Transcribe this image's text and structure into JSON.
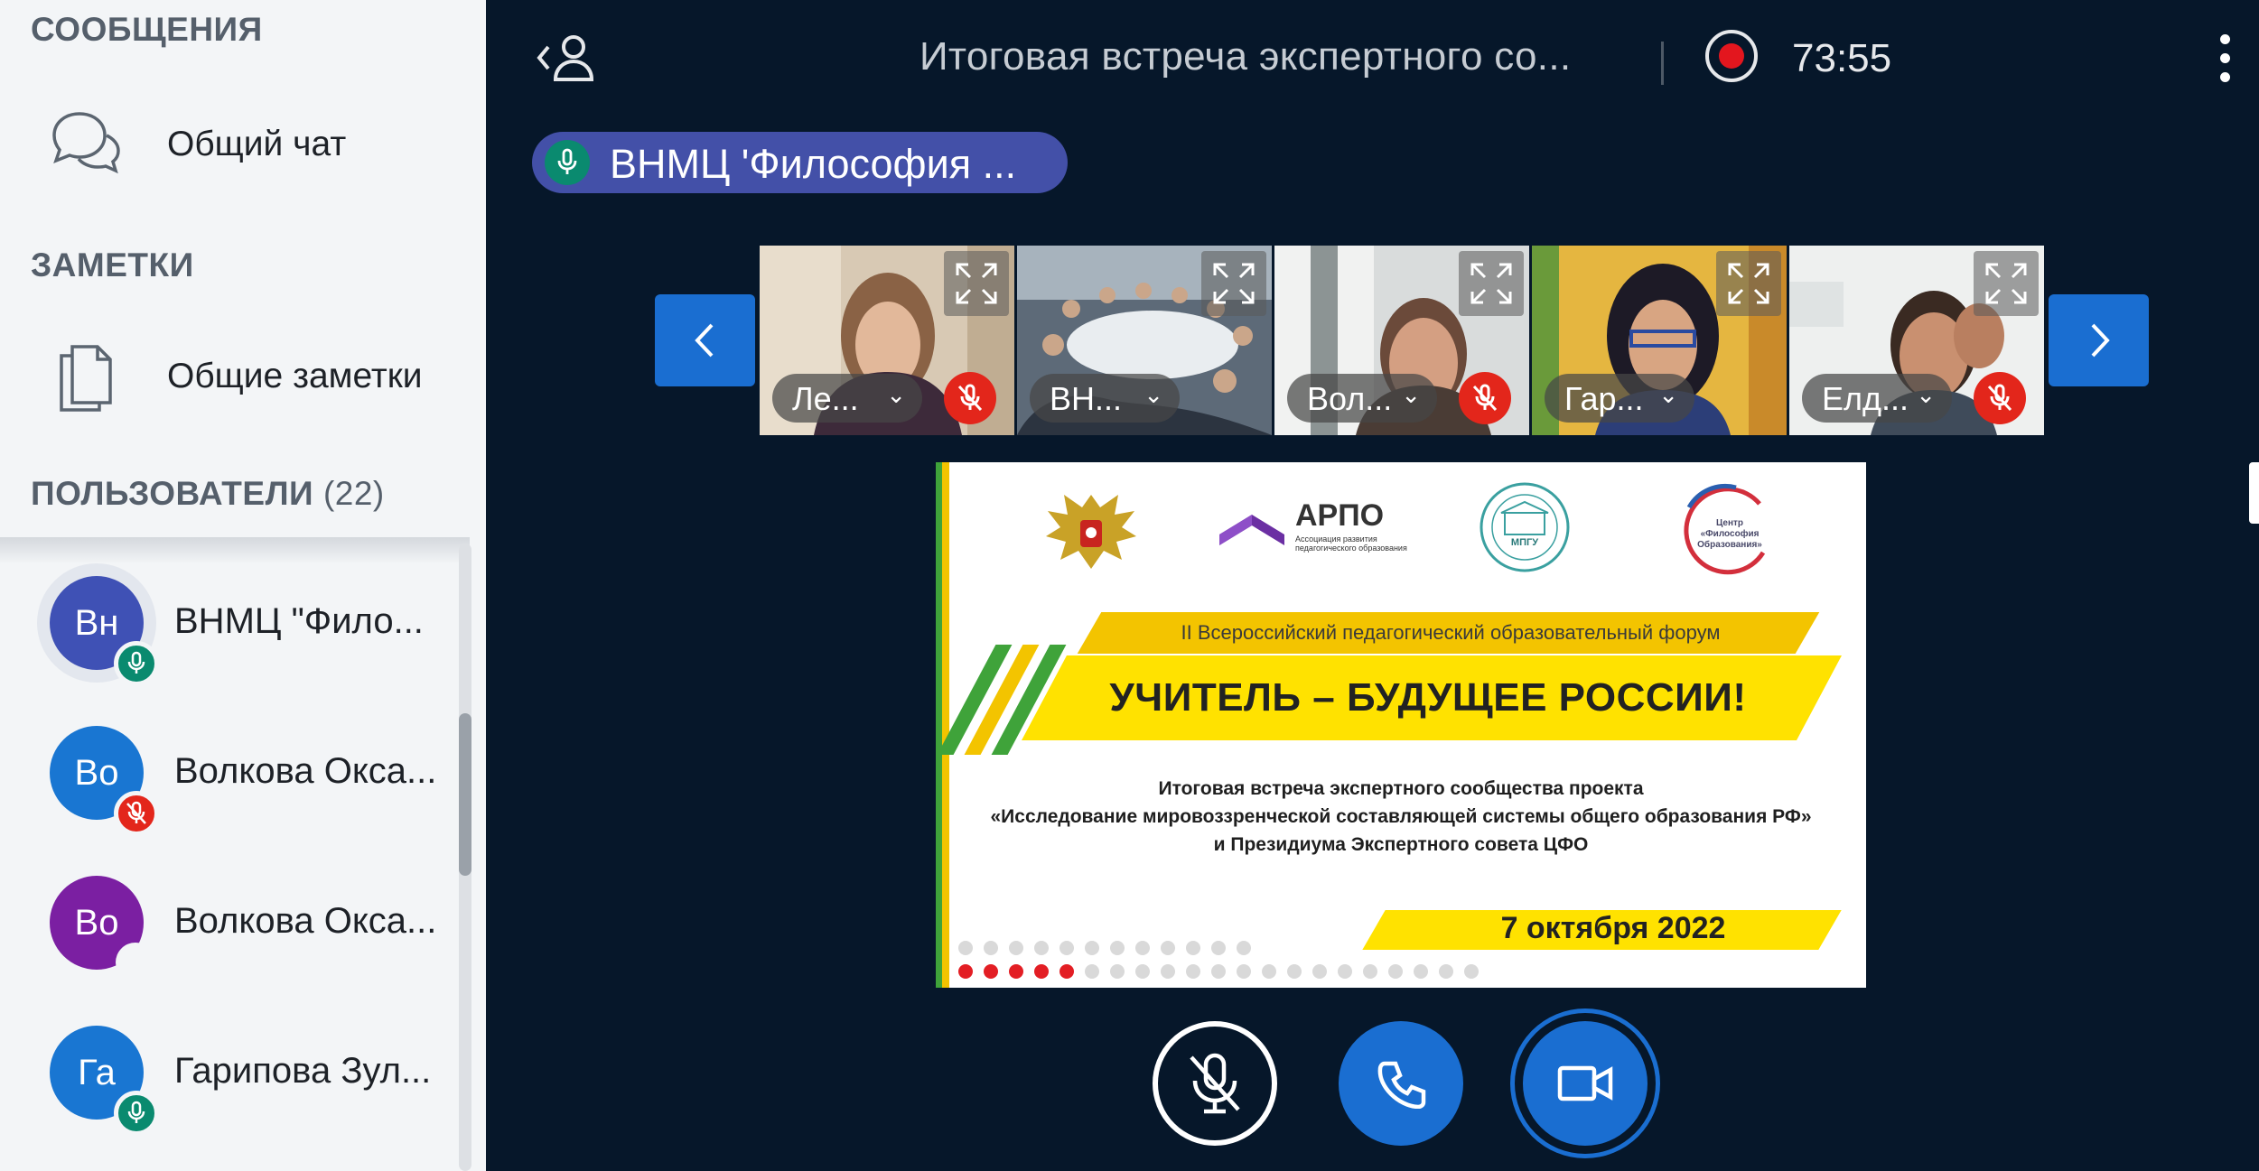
{
  "sidebar": {
    "messages_title": "СООБЩЕНИЯ",
    "public_chat": "Общий чат",
    "notes_title": "ЗАМЕТКИ",
    "shared_notes": "Общие заметки",
    "users_title": "ПОЛЬЗОВАТЕЛИ",
    "users_count": "(22)",
    "users": [
      {
        "initials": "Вн",
        "name": "ВНМЦ \"Фило...",
        "color": "#3f51b5",
        "status": "mic-on"
      },
      {
        "initials": "Во",
        "name": "Волкова Окса...",
        "color": "#1976d2",
        "status": "mic-muted"
      },
      {
        "initials": "Во",
        "name": "Волкова Окса...",
        "color": "#7b1fa2",
        "status": "none"
      },
      {
        "initials": "Га",
        "name": "Гарипова Зул...",
        "color": "#1976d2",
        "status": "mic-on"
      }
    ]
  },
  "header": {
    "title": "Итоговая встреча экспертного со...",
    "timer": "73:55"
  },
  "speaker": {
    "label": "ВНМЦ 'Философия ..."
  },
  "video_tiles": [
    {
      "name": "Ле...",
      "muted": true
    },
    {
      "name": "ВН...",
      "muted": false
    },
    {
      "name": "Вол...",
      "muted": true
    },
    {
      "name": "Гар...",
      "muted": false
    },
    {
      "name": "Елд...",
      "muted": true
    }
  ],
  "slide": {
    "arpo_title": "АРПО",
    "arpo_subtitle": "Ассоциация развития педагогического образования",
    "mpgu": "МПГУ",
    "cfo_text": "Центр «Философия Образования»",
    "forum_line": "II Всероссийский  педагогический образовательный форум",
    "headline": "УЧИТЕЛЬ – БУДУЩЕЕ РОССИИ!",
    "description_1": "Итоговая встреча экспертного сообщества проекта",
    "description_2": "«Исследование мировоззренческой составляющей системы общего образования РФ»",
    "description_3": "и Президиума Экспертного совета ЦФО",
    "date": "7 октября 2022"
  },
  "colors": {
    "accent": "#1a6ed1",
    "background": "#06172a",
    "sidebar": "#f3f5f7",
    "record": "#e3161e",
    "mic_on": "#0a8a6f",
    "muted": "#e3261b"
  }
}
